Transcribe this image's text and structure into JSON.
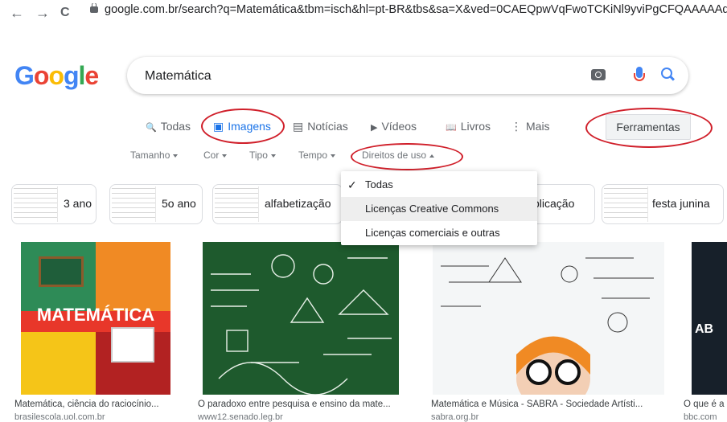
{
  "browser": {
    "back": "←",
    "forward": "→",
    "reload": "C",
    "url": "google.com.br/search?q=Matemática&tbm=isch&hl=pt-BR&tbs&sa=X&ved=0CAEQpwVqFwoTCKiNl9yviPgCFQAAAAAd"
  },
  "logo": {
    "g1": "G",
    "o1": "o",
    "o2": "o",
    "g2": "g",
    "l": "l",
    "e": "e"
  },
  "search": {
    "query": "Matemática"
  },
  "tabs": [
    {
      "icon": "🔍",
      "label": "Todas"
    },
    {
      "icon": "▣",
      "label": "Imagens"
    },
    {
      "icon": "▤",
      "label": "Notícias"
    },
    {
      "icon": "▶",
      "label": "Vídeos"
    },
    {
      "icon": "📖",
      "label": "Livros"
    },
    {
      "icon": "⋮",
      "label": "Mais"
    }
  ],
  "tools": {
    "label": "Ferramentas"
  },
  "filters": [
    "Tamanho",
    "Cor",
    "Tipo",
    "Tempo",
    "Direitos de uso"
  ],
  "menu": {
    "items": [
      "Todas",
      "Licenças Creative Commons",
      "Licenças comerciais e outras"
    ]
  },
  "chips": [
    "3 ano",
    "5o ano",
    "alfabetização",
    "plicação",
    "festa junina"
  ],
  "images": [
    {
      "caption": "Matemática, ciência do raciocínio...",
      "domain": "brasilescola.uol.com.br",
      "overlay": "MATEMÁTICA"
    },
    {
      "caption": "O paradoxo entre pesquisa e ensino da mate...",
      "domain": "www12.senado.leg.br"
    },
    {
      "caption": "Matemática e Música - SABRA - Sociedade Artísti...",
      "domain": "sabra.org.br"
    },
    {
      "caption": "O que é a",
      "domain": "bbc.com",
      "overlay": "AB"
    }
  ],
  "colors": {
    "accent": "#1a73e8",
    "annotation": "#d01f2a"
  }
}
